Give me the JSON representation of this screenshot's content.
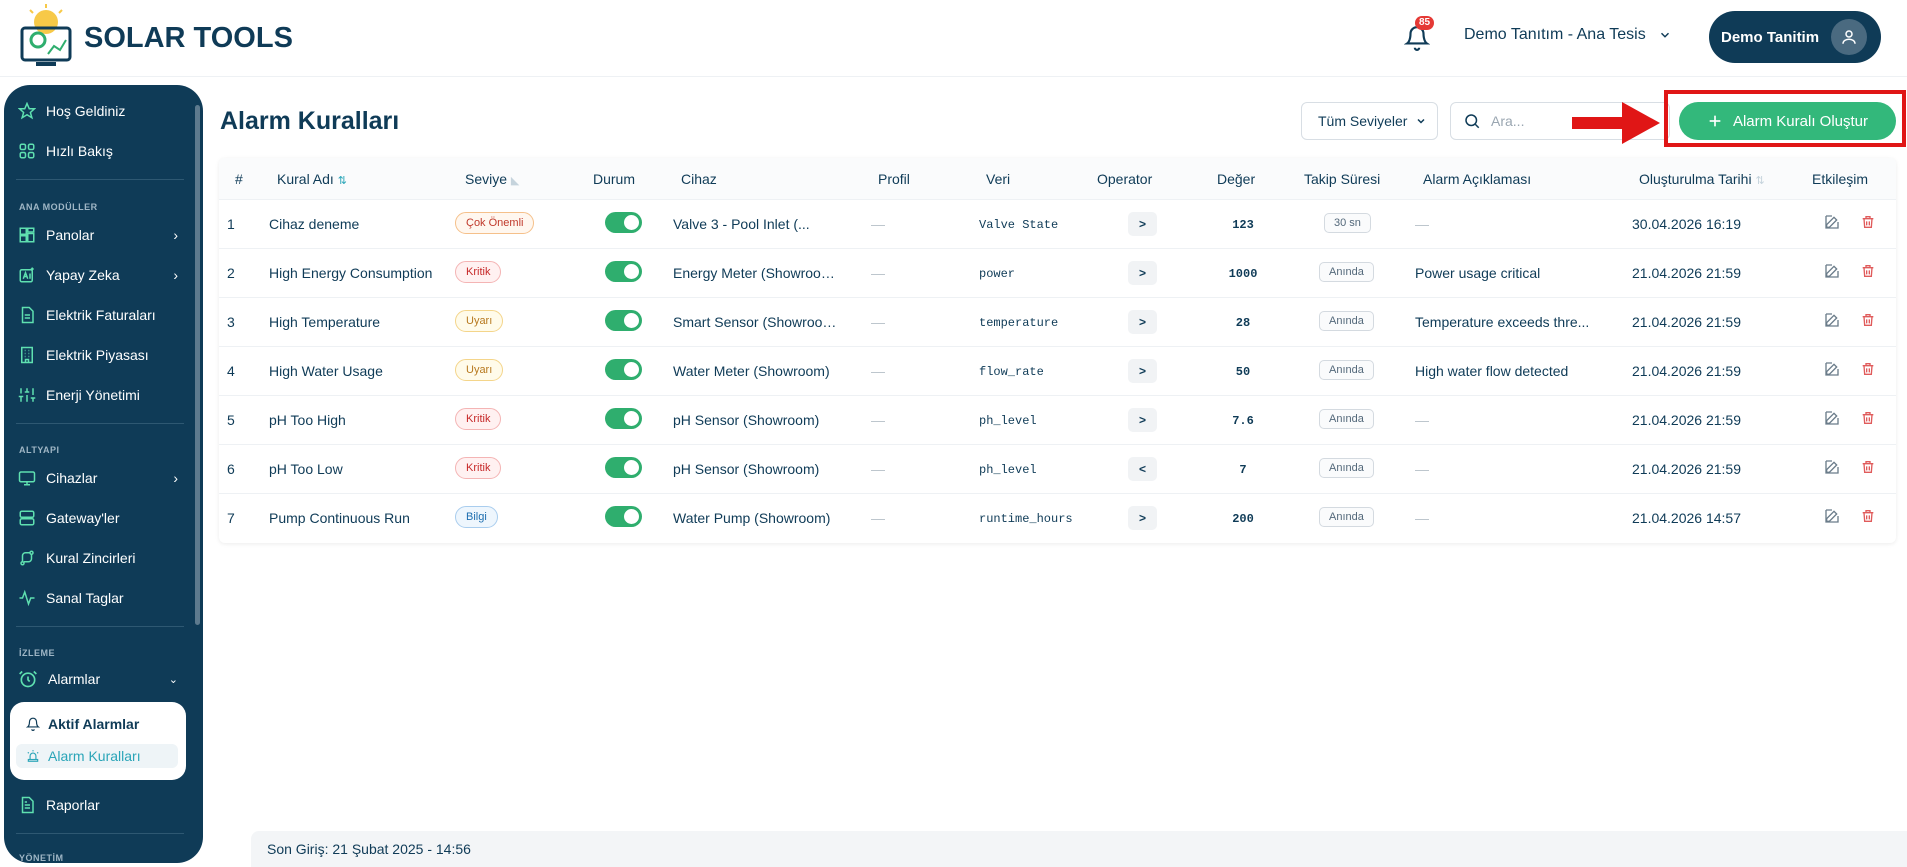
{
  "app": {
    "logo_text": "SOLAR TOOLS",
    "notification_count": "85",
    "site_selector": "Demo Tanıtım - Ana Tesis",
    "user_name": "Demo Tanitim"
  },
  "sidebar": {
    "items": [
      {
        "label": "Hoş Geldiniz",
        "icon": "star-icon"
      },
      {
        "label": "Hızlı Bakış",
        "icon": "grid-icon"
      }
    ],
    "section_main": "ANA MODÜLLER",
    "main_items": [
      {
        "label": "Panolar",
        "icon": "dashboard-icon"
      },
      {
        "label": "Yapay Zeka",
        "icon": "ai-icon"
      },
      {
        "label": "Elektrik Faturaları",
        "icon": "invoice-icon"
      },
      {
        "label": "Elektrik Piyasası",
        "icon": "building-icon"
      },
      {
        "label": "Enerji Yönetimi",
        "icon": "sliders-icon"
      }
    ],
    "section_infra": "ALTYAPI",
    "infra_items": [
      {
        "label": "Cihazlar",
        "icon": "monitor-icon"
      },
      {
        "label": "Gateway'ler",
        "icon": "server-icon"
      },
      {
        "label": "Kural Zincirleri",
        "icon": "flow-icon"
      },
      {
        "label": "Sanal Taglar",
        "icon": "activity-icon"
      }
    ],
    "section_monitor": "İZLEME",
    "monitor_items": [
      {
        "label": "Alarmlar",
        "icon": "alarm-clock-icon"
      }
    ],
    "sub_items": [
      {
        "label": "Aktif Alarmlar",
        "icon": "bell-icon"
      },
      {
        "label": "Alarm Kuralları",
        "icon": "siren-icon"
      }
    ],
    "reports": "Raporlar",
    "section_admin": "YÖNETİM"
  },
  "page": {
    "title": "Alarm Kuralları",
    "level_filter": "Tüm Seviyeler",
    "search_placeholder": "Ara...",
    "create_button": "Alarm Kuralı Oluştur"
  },
  "table": {
    "headers": [
      "#",
      "Kural Adı",
      "Seviye",
      "Durum",
      "Cihaz",
      "Profil",
      "Veri",
      "Operator",
      "Değer",
      "Takip Süresi",
      "Alarm Açıklaması",
      "Oluşturulma Tarihi",
      "Etkileşim"
    ],
    "rows": [
      {
        "no": "1",
        "name": "Cihaz deneme",
        "level": "Çok Önemli",
        "level_kind": "orange",
        "device": "Valve 3 - Pool Inlet (...",
        "profile": "—",
        "data": "Valve State",
        "op": ">",
        "value": "123",
        "duration": "30 sn",
        "desc": "—",
        "date": "30.04.2026 16:19"
      },
      {
        "no": "2",
        "name": "High Energy Consumption",
        "level": "Kritik",
        "level_kind": "red",
        "device": "Energy Meter (Showroom...",
        "profile": "—",
        "data": "power",
        "op": ">",
        "value": "1000",
        "duration": "Anında",
        "desc": "Power usage critical",
        "date": "21.04.2026 21:59"
      },
      {
        "no": "3",
        "name": "High Temperature",
        "level": "Uyarı",
        "level_kind": "yellow",
        "device": "Smart Sensor (Showroom...",
        "profile": "—",
        "data": "temperature",
        "op": ">",
        "value": "28",
        "duration": "Anında",
        "desc": "Temperature exceeds thre...",
        "date": "21.04.2026 21:59"
      },
      {
        "no": "4",
        "name": "High Water Usage",
        "level": "Uyarı",
        "level_kind": "yellow",
        "device": "Water Meter (Showroom)",
        "profile": "—",
        "data": "flow_rate",
        "op": ">",
        "value": "50",
        "duration": "Anında",
        "desc": "High water flow detected",
        "date": "21.04.2026 21:59"
      },
      {
        "no": "5",
        "name": "pH Too High",
        "level": "Kritik",
        "level_kind": "red",
        "device": "pH Sensor (Showroom)",
        "profile": "—",
        "data": "ph_level",
        "op": ">",
        "value": "7.6",
        "duration": "Anında",
        "desc": "—",
        "date": "21.04.2026 21:59"
      },
      {
        "no": "6",
        "name": "pH Too Low",
        "level": "Kritik",
        "level_kind": "red",
        "device": "pH Sensor (Showroom)",
        "profile": "—",
        "data": "ph_level",
        "op": "<",
        "value": "7",
        "duration": "Anında",
        "desc": "—",
        "date": "21.04.2026 21:59"
      },
      {
        "no": "7",
        "name": "Pump Continuous Run",
        "level": "Bilgi",
        "level_kind": "blue",
        "device": "Water Pump (Showroom)",
        "profile": "—",
        "data": "runtime_hours",
        "op": ">",
        "value": "200",
        "duration": "Anında",
        "desc": "—",
        "date": "21.04.2026 14:57"
      }
    ]
  },
  "footer": {
    "last_login": "Son Giriş: 21 Şubat 2025 - 14:56"
  },
  "colors": {
    "brand": "#0f3b57",
    "accent_green": "#33b87b",
    "highlight_red": "#e01616"
  }
}
